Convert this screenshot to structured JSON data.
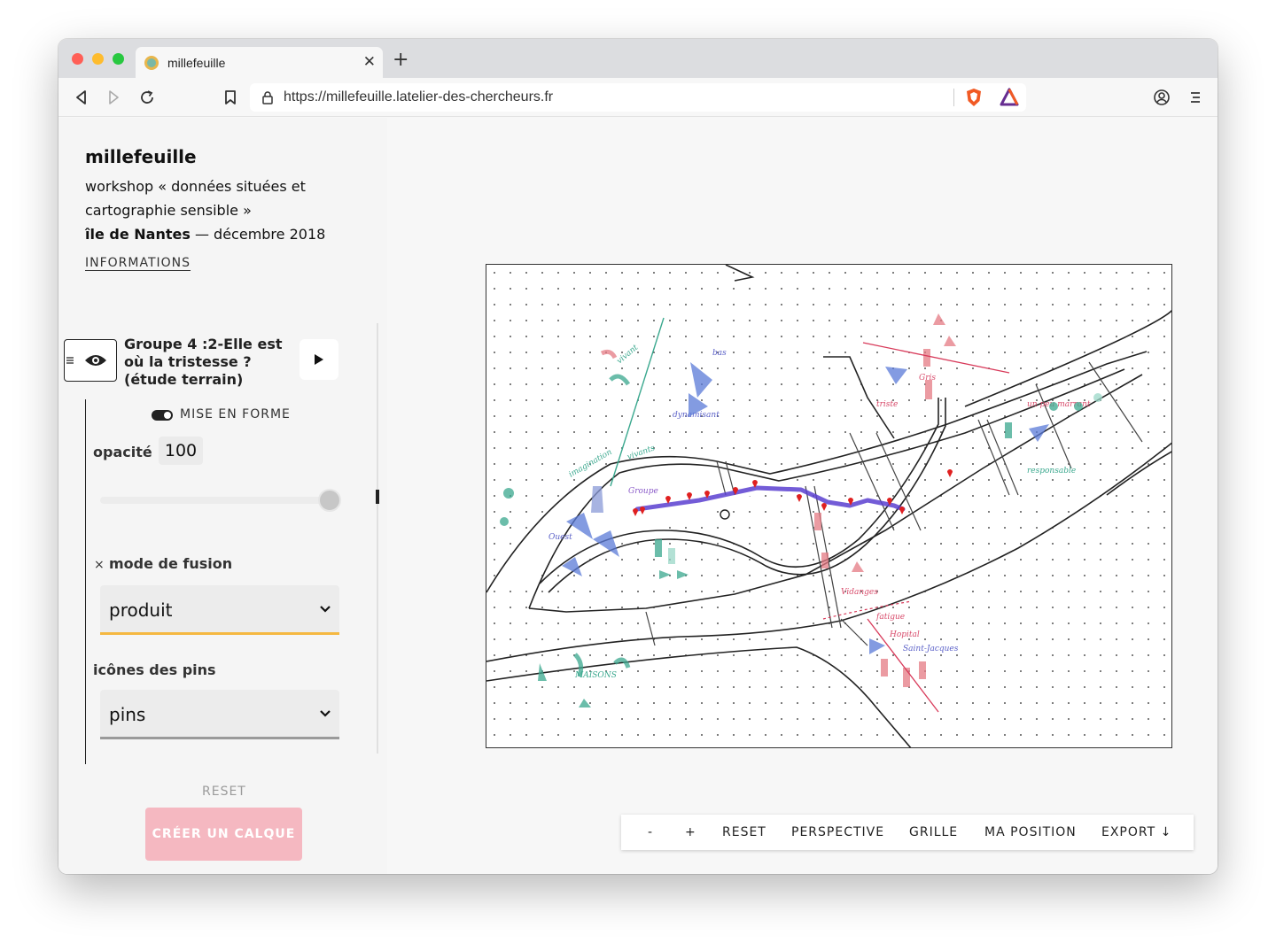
{
  "browser": {
    "tab_title": "millefeuille",
    "url": "https://millefeuille.latelier-des-chercheurs.fr"
  },
  "sidebar": {
    "title": "millefeuille",
    "subtitle": "workshop « données situées et cartographie sensible »",
    "place_bold": "île de Nantes",
    "place_rest": " — décembre 2018",
    "info_link": "INFORMATIONS",
    "layer": {
      "name": "Groupe 4 :2-Elle est où la tristesse ? (étude terrain)",
      "toggle_label": "MISE EN FORME",
      "opacity_label": "opacité",
      "opacity_value": "100",
      "opacity_level": 100,
      "blend_remove": "×",
      "blend_label": "mode de fusion",
      "blend_value": "produit",
      "pins_label": "icônes des pins",
      "pins_value": "pins"
    },
    "reset_label": "RESET",
    "create_label": "CRÉER UN CALQUE"
  },
  "map_toolbar": {
    "zoom_out": "-",
    "zoom_in": "+",
    "reset": "RESET",
    "perspective": "PERSPECTIVE",
    "grid": "GRILLE",
    "position": "MA POSITION",
    "export": "EXPORT ↓"
  },
  "colors": {
    "accent_yellow": "#f5b841",
    "button_pink": "#f5b8c1",
    "route_purple": "#5b3fd0",
    "pin_red": "#e02020"
  }
}
